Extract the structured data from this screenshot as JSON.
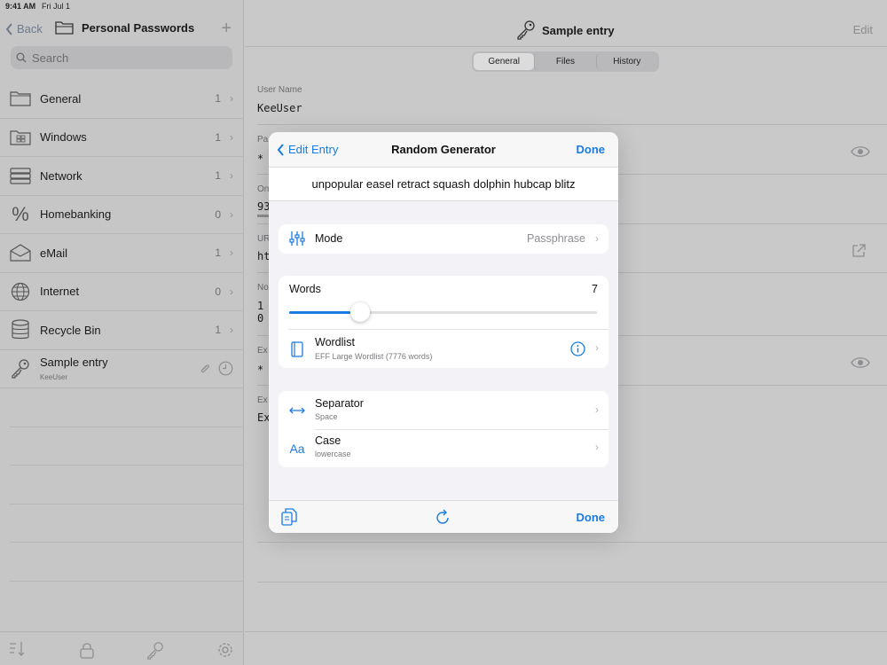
{
  "status": {
    "time": "9:41 AM",
    "date": "Fri Jul 1"
  },
  "sidebar": {
    "back_label": "Back",
    "title": "Personal Passwords",
    "search_placeholder": "Search",
    "groups": [
      {
        "label": "General",
        "count": "1",
        "icon": "folder-icon"
      },
      {
        "label": "Windows",
        "count": "1",
        "icon": "windows-icon"
      },
      {
        "label": "Network",
        "count": "1",
        "icon": "server-icon"
      },
      {
        "label": "Homebanking",
        "count": "0",
        "icon": "percent-icon"
      },
      {
        "label": "eMail",
        "count": "1",
        "icon": "envelope-icon"
      },
      {
        "label": "Internet",
        "count": "0",
        "icon": "globe-icon"
      },
      {
        "label": "Recycle Bin",
        "count": "1",
        "icon": "database-icon"
      }
    ],
    "entry": {
      "title": "Sample entry",
      "username": "KeeUser",
      "icon": "key-icon"
    }
  },
  "detail": {
    "title": "Sample entry",
    "edit_label": "Edit",
    "tabs": [
      "General",
      "Files",
      "History"
    ],
    "active_tab": "General",
    "fields": [
      {
        "label": "User Name",
        "value": "KeeUser"
      },
      {
        "label": "Pa",
        "value": "*"
      },
      {
        "label": "On",
        "value": "93"
      },
      {
        "label": "UR",
        "value": "ht"
      },
      {
        "label": "No",
        "value": "1"
      },
      {
        "label": "",
        "value": "0"
      },
      {
        "label": "Ex",
        "value": "*"
      },
      {
        "label": "Ex",
        "value": "Ex"
      }
    ]
  },
  "generator": {
    "back_label": "Edit Entry",
    "title": "Random Generator",
    "done_label": "Done",
    "passphrase": "unpopular easel retract squash dolphin hubcap blitz",
    "mode": {
      "label": "Mode",
      "value": "Passphrase"
    },
    "words": {
      "label": "Words",
      "value": "7",
      "slider_fraction": 0.2
    },
    "wordlist": {
      "label": "Wordlist",
      "sub": "EFF Large Wordlist (7776 words)"
    },
    "separator": {
      "label": "Separator",
      "sub": "Space"
    },
    "case": {
      "label": "Case",
      "sub": "lowercase",
      "icon_text": "Aa"
    },
    "toolbar_done": "Done"
  },
  "colors": {
    "accent": "#1a7be0",
    "dimmed_bg": "#c9c9ca",
    "sheet_bg": "#f2f2f7"
  }
}
